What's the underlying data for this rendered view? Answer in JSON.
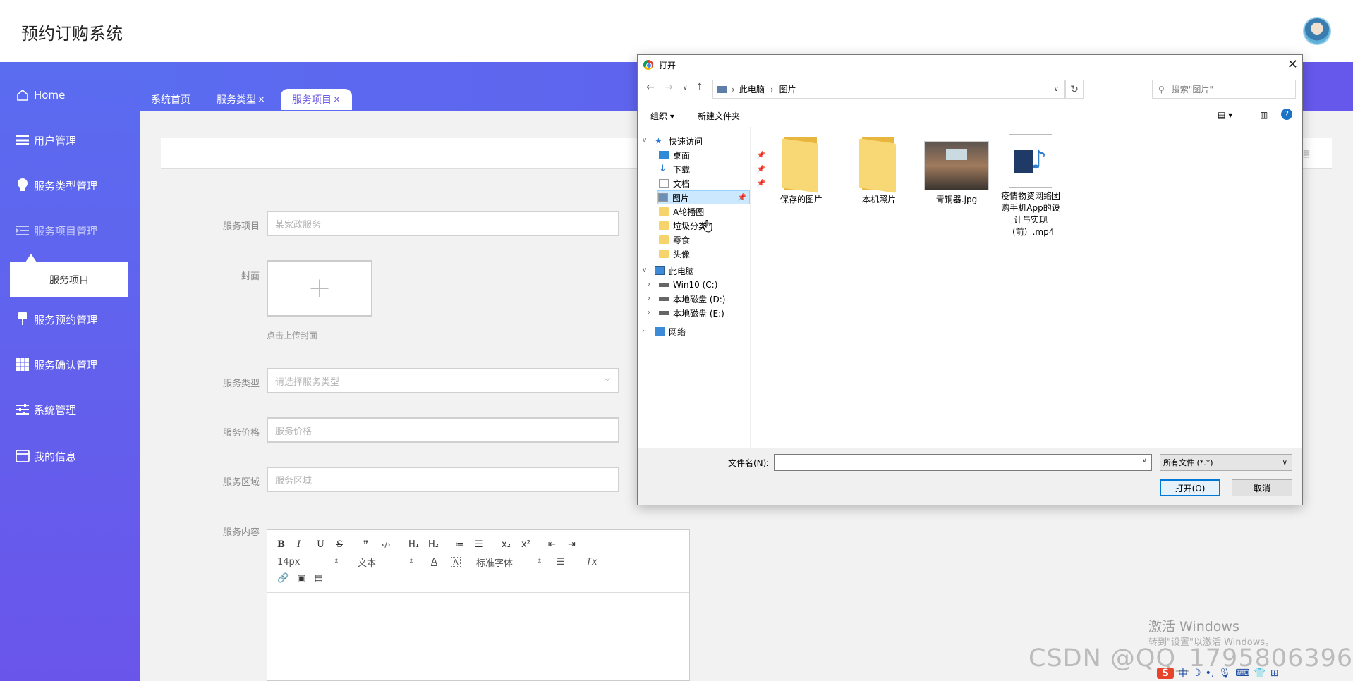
{
  "app": {
    "title": "预约订购系统"
  },
  "sidebar": {
    "items": [
      {
        "label": "Home",
        "icon": "home-icon"
      },
      {
        "label": "用户管理",
        "icon": "list-icon"
      },
      {
        "label": "服务类型管理",
        "icon": "bulb-icon"
      },
      {
        "label": "服务项目管理",
        "icon": "outdent-icon"
      },
      {
        "label": "服务预约管理",
        "icon": "pin-icon"
      },
      {
        "label": "服务确认管理",
        "icon": "grid-icon"
      },
      {
        "label": "系统管理",
        "icon": "sliders-icon"
      },
      {
        "label": "我的信息",
        "icon": "card-icon"
      }
    ],
    "submenu": "服务项目"
  },
  "tabs": [
    {
      "label": "系统首页"
    },
    {
      "label": "服务类型",
      "close": "×"
    },
    {
      "label": "服务项目",
      "close": "×"
    }
  ],
  "card_text": "目",
  "form": {
    "item_label": "服务项目",
    "item_placeholder": "某家政服务",
    "cover_label": "封面",
    "upload_plus": "+",
    "upload_hint": "点击上传封面",
    "type_label": "服务类型",
    "type_placeholder": "请选择服务类型",
    "price_label": "服务价格",
    "price_placeholder": "服务价格",
    "area_label": "服务区域",
    "area_placeholder": "服务区域",
    "content_label": "服务内容"
  },
  "editor": {
    "row1": [
      "B",
      "I",
      "U",
      "S",
      "❞",
      "‹/›",
      "H₁",
      "H₂",
      "≔",
      "☰",
      "x₂",
      "x²",
      "⇤",
      "⇥"
    ],
    "font_size": "14px",
    "text_type": "文本",
    "font_family": "标准字体",
    "clear": "Tx"
  },
  "dialog": {
    "title": "打开",
    "close": "✕",
    "path": [
      "此电脑",
      "›",
      "图片"
    ],
    "search_placeholder": "搜索\"图片\"",
    "organize": "组织 ▾",
    "new_folder": "新建文件夹",
    "tree": [
      {
        "label": "快速访问"
      },
      {
        "label": "桌面"
      },
      {
        "label": "下载"
      },
      {
        "label": "文档"
      },
      {
        "label": "图片"
      },
      {
        "label": "A轮播图"
      },
      {
        "label": "垃圾分类"
      },
      {
        "label": "零食"
      },
      {
        "label": "头像"
      },
      {
        "label": "此电脑"
      },
      {
        "label": "Win10 (C:)"
      },
      {
        "label": "本地磁盘 (D:)"
      },
      {
        "label": "本地磁盘 (E:)"
      },
      {
        "label": "网络"
      }
    ],
    "files": [
      {
        "name": "保存的图片"
      },
      {
        "name": "本机照片"
      },
      {
        "name": "青铜器.jpg"
      },
      {
        "name": "疫情物资网络团购手机App的设计与实现（前）.mp4"
      }
    ],
    "filename_label": "文件名(N):",
    "filename_value": "",
    "filetype": "所有文件 (*.*)",
    "open_button": "打开(O)",
    "cancel_button": "取消"
  },
  "watermark": {
    "line1": "激活 Windows",
    "line2": "转到\"设置\"以激活 Windows。",
    "csdn": "CSDN @QQ_1795806396"
  },
  "tray": {
    "ime": "中"
  }
}
